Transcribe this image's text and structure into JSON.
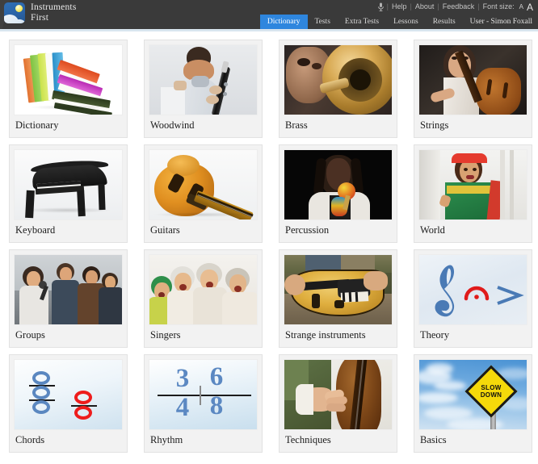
{
  "header": {
    "logo_icon": "sun-cloud-logo-icon",
    "brand_line1": "Instruments",
    "brand_line2": "First",
    "utility": {
      "mic_icon": "microphone-icon",
      "help": "Help",
      "about": "About",
      "feedback": "Feedback",
      "font_size_label": "Font size:",
      "font_size_small": "A",
      "font_size_large": "A",
      "separator": "|"
    },
    "tabs": [
      {
        "label": "Dictionary",
        "active": true
      },
      {
        "label": "Tests",
        "active": false
      },
      {
        "label": "Extra Tests",
        "active": false
      },
      {
        "label": "Lessons",
        "active": false
      },
      {
        "label": "Results",
        "active": false
      },
      {
        "label": "User - Simon Foxall",
        "active": false
      }
    ],
    "accent_color": "#2e86de",
    "bar_color": "#3b3b3b"
  },
  "grid": {
    "cards": [
      {
        "label": "Dictionary",
        "art": "books"
      },
      {
        "label": "Woodwind",
        "art": "woodwind"
      },
      {
        "label": "Brass",
        "art": "brass"
      },
      {
        "label": "Strings",
        "art": "strings"
      },
      {
        "label": "Keyboard",
        "art": "keyboard"
      },
      {
        "label": "Guitars",
        "art": "guitar"
      },
      {
        "label": "Percussion",
        "art": "percussion"
      },
      {
        "label": "World",
        "art": "world"
      },
      {
        "label": "Groups",
        "art": "groups"
      },
      {
        "label": "Singers",
        "art": "singers"
      },
      {
        "label": "Strange instruments",
        "art": "strange"
      },
      {
        "label": "Theory",
        "art": "theory"
      },
      {
        "label": "Chords",
        "art": "chords"
      },
      {
        "label": "Rhythm",
        "art": "rhythm"
      },
      {
        "label": "Techniques",
        "art": "techniques"
      },
      {
        "label": "Basics",
        "art": "basics"
      }
    ]
  },
  "art_text": {
    "rhythm_top_left": "3",
    "rhythm_bottom_left": "4",
    "rhythm_top_right": "6",
    "rhythm_bottom_right": "8",
    "basics_sign_line1": "SLOW",
    "basics_sign_line2": "DOWN"
  }
}
